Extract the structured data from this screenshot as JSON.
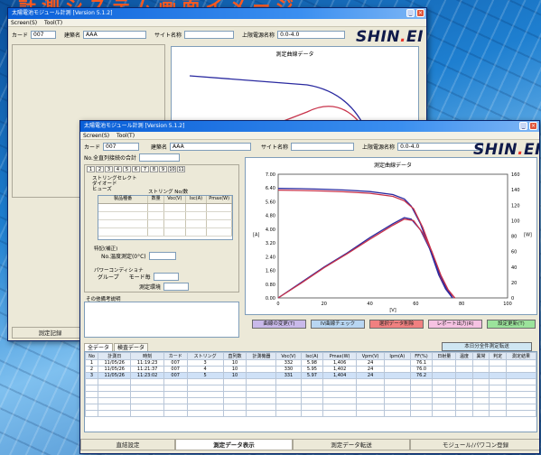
{
  "banner": {
    "text": "計測システム画面イメージ"
  },
  "back": {
    "title": "太陽電池モジュール計測 [Version 5.1.2]",
    "menu": [
      "Screen(S)",
      "Tool(T)"
    ],
    "card_label": "カード",
    "card_value": "007",
    "name_label": "建築名",
    "name_value": "AAA",
    "site_label": "サイト名称",
    "power_label": "上限電源名称",
    "power_value": "0.0-4.0",
    "logo": "SHIN",
    "logo_dot": ".",
    "logo_tail": "EI",
    "chart_title": "測定曲線データ",
    "bottom_tab_label": "測定記録"
  },
  "front": {
    "title": "太陽電池モジュール計測 [Version 5.1.2]",
    "menu": [
      "Screen(S)",
      "Tool(T)"
    ],
    "card_label": "カード",
    "card_value": "007",
    "name_label": "建築名",
    "name_value": "AAA",
    "site_label": "サイト名称",
    "power_label": "上限電源名称",
    "power_value": "0.0-4.0",
    "logo": "SHIN",
    "logo_dot": ".",
    "logo_tail": "EI",
    "module_label": "No.全直列接続の合計",
    "tab_numbers": [
      "1",
      "2",
      "3",
      "4",
      "5",
      "6",
      "7",
      "8",
      "9",
      "10",
      "11"
    ],
    "string_lines": [
      "ストリングセレクト",
      "ダイオード",
      "ヒューズ"
    ],
    "string_count_label": "ストリング No/数",
    "subgrid_headers": [
      "製品種番",
      "数量",
      "Voc(V)",
      "Isc(A)",
      "Pmax(W)"
    ],
    "temp_section": "特記(補正)",
    "temp_label": "No.温度測定(0°C)",
    "power_section": "パワーコンディショナ",
    "group_label": "グループ",
    "mode_label": "モード毎",
    "env_label": "測定環境",
    "remarks_label": "その他備考説明",
    "chart_title": "測定曲線データ",
    "y_left_ticks": [
      "7.00",
      "6.40",
      "5.60",
      "4.80",
      "4.00",
      "3.20",
      "2.40",
      "1.60",
      "0.80",
      "0.00"
    ],
    "y_right_ticks": [
      "160",
      "140",
      "120",
      "100",
      "80",
      "60",
      "40",
      "20",
      "0"
    ],
    "x_ticks": [
      "0",
      "20",
      "40",
      "60",
      "80",
      "100"
    ],
    "y_left_unit": "[A]",
    "y_right_unit": "[W]",
    "x_unit": "[V]",
    "buttons": [
      {
        "label": "曲線の変更(T)",
        "color": "#c9b9ea"
      },
      {
        "label": "IV曲線チェック",
        "color": "#b8d6f2"
      },
      {
        "label": "選択データ削除",
        "color": "#f08080"
      },
      {
        "label": "レポート出力(R)",
        "color": "#f6c2e2"
      },
      {
        "label": "設定更新(T)",
        "color": "#9be39b"
      }
    ],
    "top_right_button": "本日分全件測定転送",
    "data_tabs": [
      "全データ",
      "検査データ"
    ],
    "table_headers": [
      "No",
      "計測日",
      "時刻",
      "カード",
      "ストリング",
      "直列数",
      "計測機器",
      "Voc(V)",
      "Isc(A)",
      "Pmax(W)",
      "Vpm(V)",
      "Ipm(A)",
      "FF(%)",
      "日射量",
      "温度",
      "異常",
      "判定",
      "測定結果"
    ],
    "table_rows": [
      [
        "1",
        "11/05/26",
        "11:19:23",
        "007",
        "3",
        "10",
        "",
        "332",
        "5.98",
        "1,406",
        "24",
        "",
        "76.1",
        "",
        "",
        "",
        "",
        ""
      ],
      [
        "2",
        "11/05/26",
        "11:21:37",
        "007",
        "4",
        "10",
        "",
        "330",
        "5.95",
        "1,402",
        "24",
        "",
        "76.0",
        "",
        "",
        "",
        "",
        ""
      ],
      [
        "3",
        "11/05/26",
        "11:23:02",
        "007",
        "5",
        "10",
        "",
        "331",
        "5.97",
        "1,404",
        "24",
        "",
        "76.2",
        "",
        "",
        "",
        "",
        ""
      ]
    ],
    "bottom_tabs": [
      "直結設定",
      "測定データ表示",
      "測定データ転送",
      "モジュール/パワコン登録"
    ],
    "chart_data": {
      "type": "line",
      "title": "測定曲線データ",
      "xlabel": "[V]",
      "ylabel": "[A]",
      "ylabel_right": "[W]",
      "xlim": [
        0,
        100
      ],
      "ylim": [
        0,
        7
      ],
      "ylim_right": [
        0,
        160
      ],
      "series": [
        {
          "color": "#2a2aa0",
          "axis": "left",
          "x": [
            0,
            10,
            20,
            30,
            40,
            50,
            55,
            58,
            62,
            66,
            70,
            73,
            76
          ],
          "y": [
            6.2,
            6.18,
            6.15,
            6.1,
            6.02,
            5.85,
            5.6,
            5.2,
            4.2,
            2.8,
            1.3,
            0.5,
            0.0
          ]
        },
        {
          "color": "#c8324a",
          "axis": "left",
          "x": [
            0,
            10,
            20,
            30,
            40,
            50,
            55,
            59,
            63,
            67,
            71,
            74,
            77
          ],
          "y": [
            6.1,
            6.08,
            6.05,
            6.0,
            5.92,
            5.75,
            5.5,
            5.05,
            4.0,
            2.6,
            1.1,
            0.4,
            0.0
          ]
        },
        {
          "color": "#2a2aa0",
          "axis": "right",
          "x": [
            0,
            10,
            20,
            30,
            40,
            50,
            55,
            58,
            62,
            66,
            70,
            73,
            76
          ],
          "y": [
            0,
            20,
            40,
            58,
            78,
            96,
            104,
            102,
            88,
            64,
            33,
            14,
            0
          ]
        },
        {
          "color": "#c8324a",
          "axis": "right",
          "x": [
            0,
            10,
            20,
            30,
            40,
            50,
            55,
            59,
            63,
            67,
            71,
            74,
            77
          ],
          "y": [
            0,
            19,
            39,
            57,
            76,
            94,
            102,
            100,
            84,
            60,
            29,
            11,
            0
          ]
        }
      ]
    }
  }
}
